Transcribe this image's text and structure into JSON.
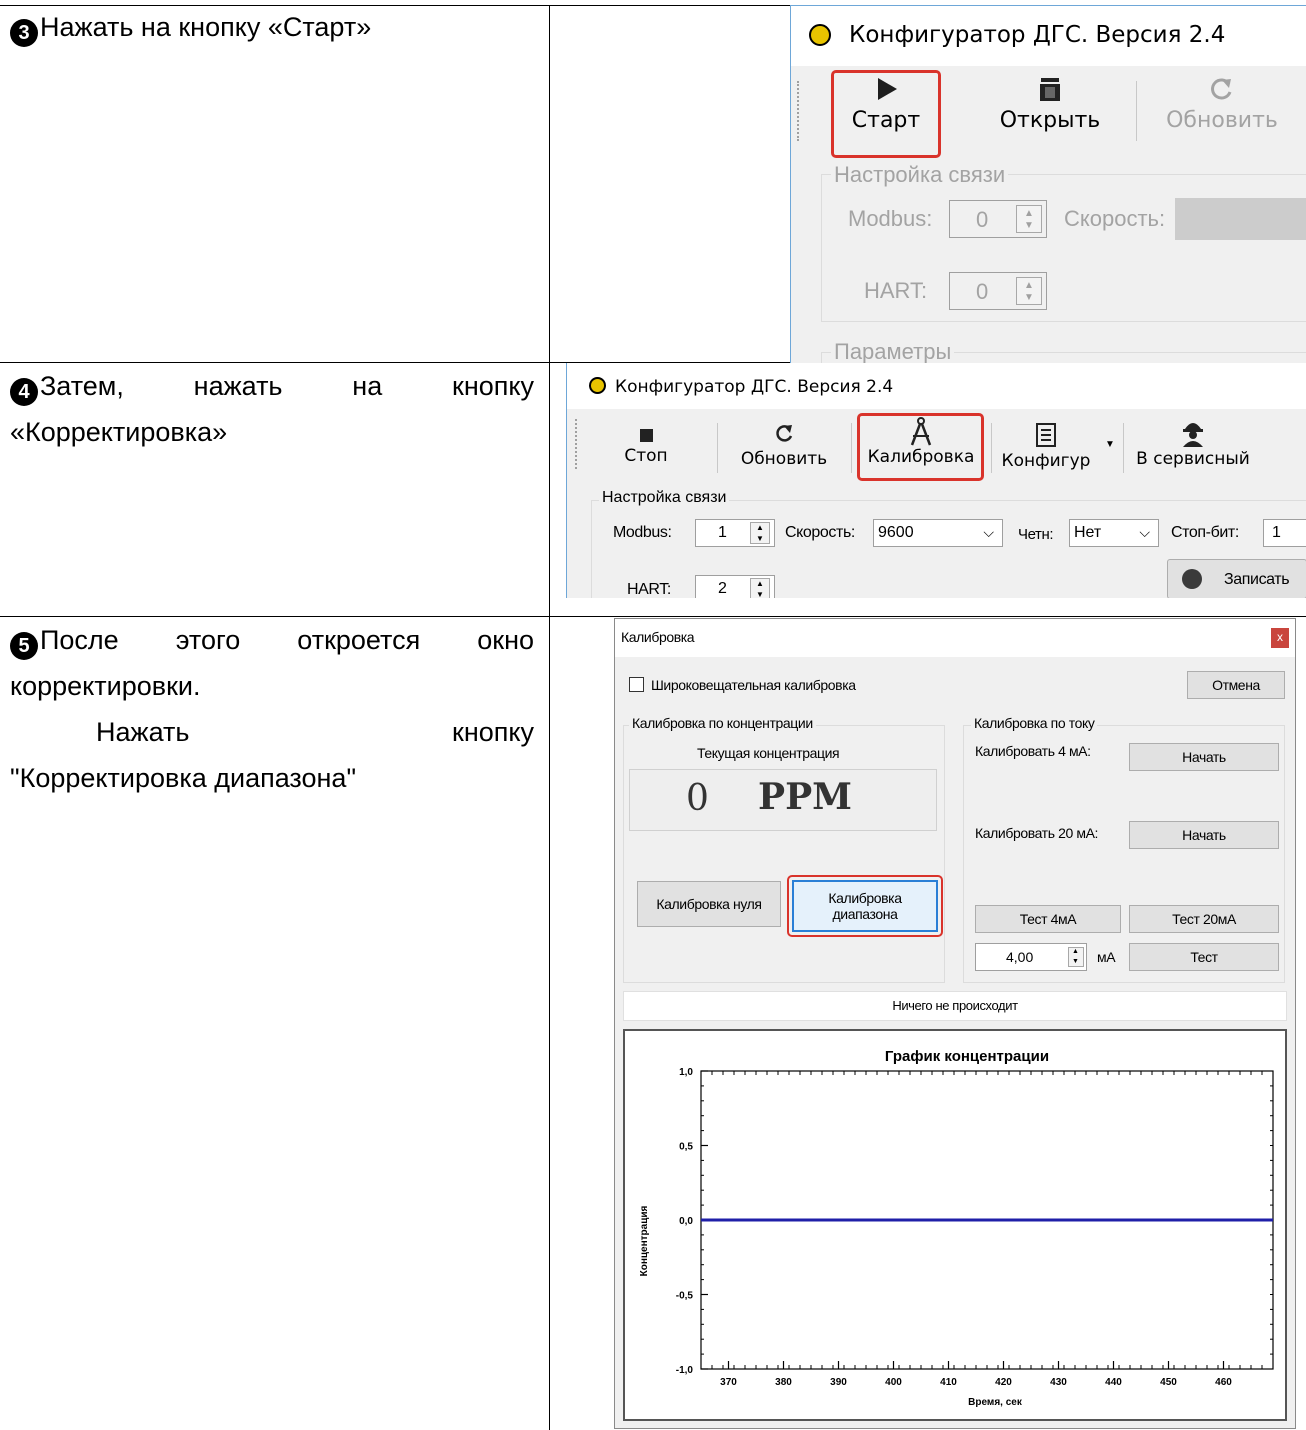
{
  "steps": [
    {
      "num": "3",
      "text": "Нажать на кнопку «Старт»"
    },
    {
      "num": "4",
      "line1": [
        "Затем,",
        "нажать",
        "на",
        "кнопку"
      ],
      "line2": "«Корректировка»"
    },
    {
      "num": "5",
      "line1": [
        "После",
        "этого",
        "откроется",
        "окно"
      ],
      "line2": "корректировки.",
      "line3": [
        "Нажать",
        "кнопку"
      ],
      "line4": "\"Корректировка диапазона\""
    }
  ],
  "shot1": {
    "title": "Конфигуратор ДГС. Версия 2.4",
    "buttons": {
      "start": "Старт",
      "open": "Открыть",
      "refresh": "Обновить"
    },
    "group_comm": "Настройка связи",
    "modbus_label": "Modbus:",
    "modbus_value": "0",
    "speed_label": "Скорость:",
    "hart_label": "HART:",
    "hart_value": "0",
    "group_params": "Параметры"
  },
  "shot2": {
    "title": "Конфигуратор ДГС. Версия 2.4",
    "buttons": {
      "stop": "Стоп",
      "refresh": "Обновить",
      "calibration": "Калибровка",
      "config": "Конфигур",
      "service": "В сервисный"
    },
    "group_comm": "Настройка связи",
    "modbus_label": "Modbus:",
    "modbus_value": "1",
    "speed_label": "Скорость:",
    "speed_value": "9600",
    "parity_label": "Четн:",
    "parity_value": "Нет",
    "stopbit_label": "Стоп-бит:",
    "stopbit_value": "1",
    "hart_label": "HART:",
    "hart_value": "2",
    "write_button": "Записать"
  },
  "shot3": {
    "title": "Калибровка",
    "close": "x",
    "broadcast_label": "Широковещательная калибровка",
    "cancel_button": "Отмена",
    "group_conc": "Калибровка по концентрации",
    "current_conc_label": "Текущая концентрация",
    "conc_value": "0",
    "conc_unit": "PPM",
    "zero_button": "Калибровка нуля",
    "span_button_l1": "Калибровка",
    "span_button_l2": "диапазона",
    "group_current": "Калибровка по току",
    "cal4_label": "Калибровать 4 мА:",
    "cal20_label": "Калибровать 20 мА:",
    "start_button": "Начать",
    "test4_button": "Тест 4мА",
    "test20_button": "Тест 20мА",
    "ma_value": "4,00",
    "ma_unit": "мА",
    "test_button": "Тест",
    "status": "Ничего не происходит"
  },
  "chart_data": {
    "type": "line",
    "title": "График концентрации",
    "xlabel": "Время, сек",
    "ylabel": "Концентрация",
    "xlim": [
      365,
      469
    ],
    "ylim": [
      -1.0,
      1.0
    ],
    "x_ticks": [
      "370",
      "380",
      "390",
      "400",
      "410",
      "420",
      "430",
      "440",
      "450",
      "460"
    ],
    "y_ticks": [
      "1,0",
      "0,5",
      "0,0",
      "-0,5",
      "-1,0"
    ],
    "series": [
      {
        "x": [
          365,
          469
        ],
        "y": [
          0.0,
          0.0
        ],
        "color": "#1f1fa8"
      }
    ],
    "grid": false
  }
}
